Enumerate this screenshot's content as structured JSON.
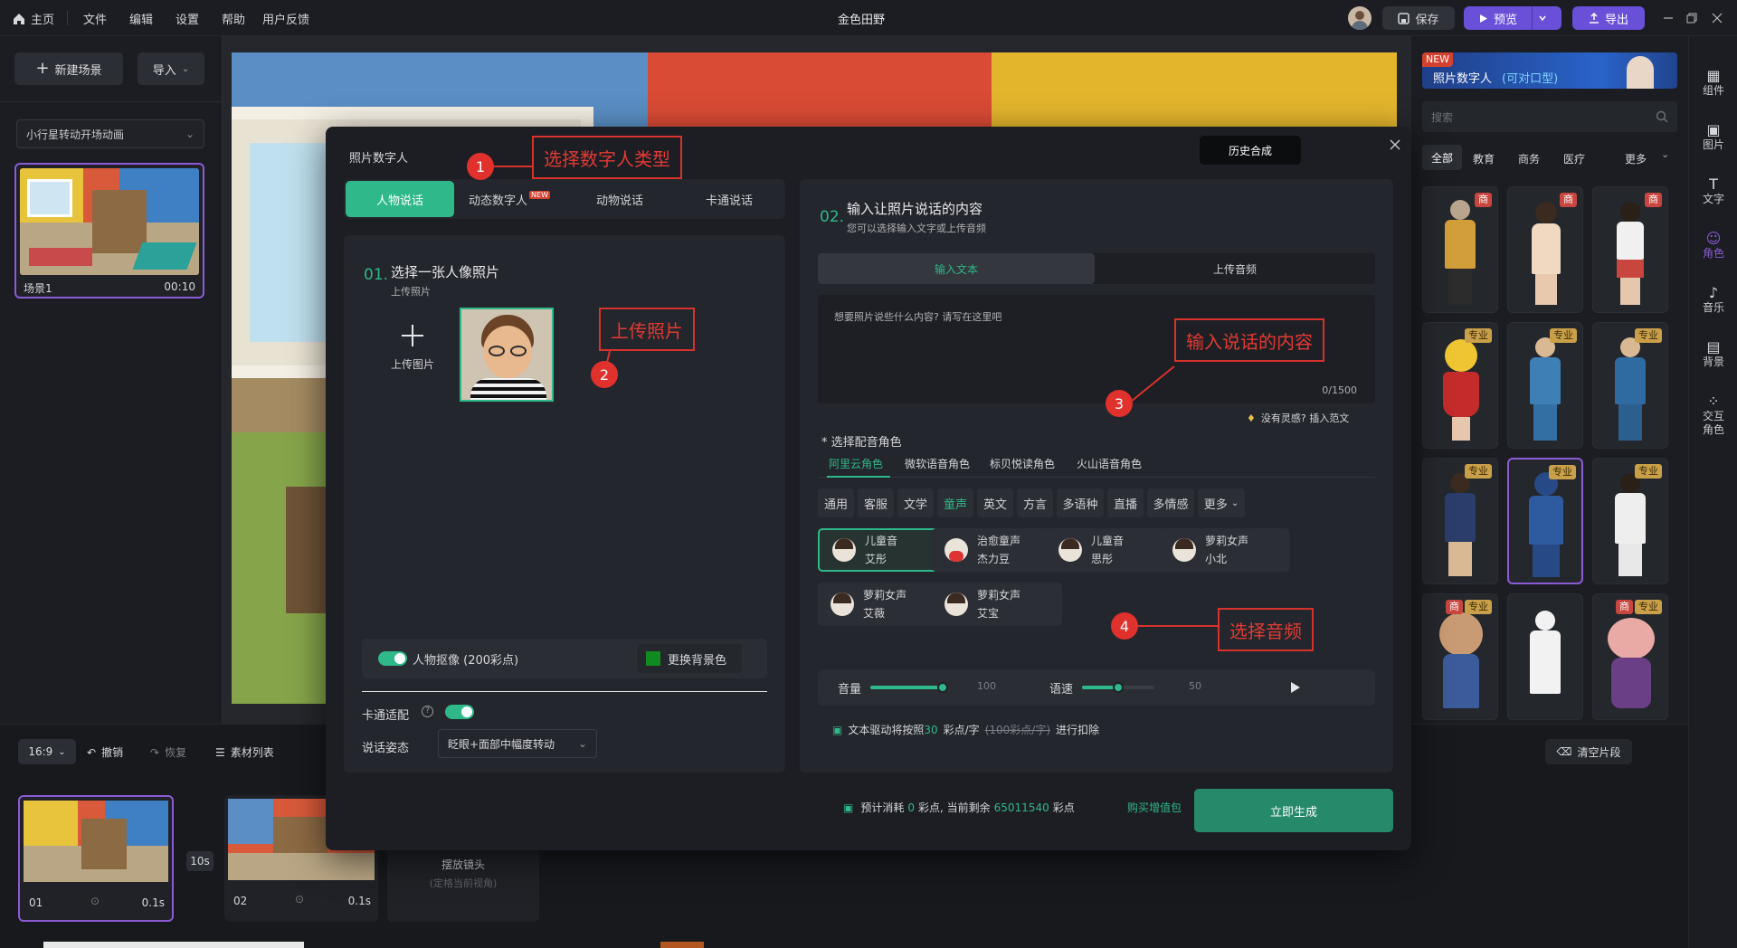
{
  "topbar": {
    "home": "主页",
    "menus": [
      "文件",
      "编辑",
      "设置",
      "帮助",
      "用户反馈"
    ],
    "title": "金色田野",
    "save": "保存",
    "preview": "预览",
    "export": "导出"
  },
  "left": {
    "new_scene": "新建场景",
    "import": "导入",
    "animation_select": "小行星转动开场动画",
    "scene_name": "场景1",
    "scene_duration": "00:10"
  },
  "assets": {
    "banner_new": "NEW",
    "banner_title": "照片数字人",
    "banner_sub": "(可对口型)",
    "search_placeholder": "搜索",
    "tabs": [
      "全部",
      "教育",
      "商务",
      "医疗",
      "更多"
    ],
    "tag_shang": "商",
    "tag_pro": "专业"
  },
  "rightbar": [
    "组件",
    "图片",
    "文字",
    "角色",
    "音乐",
    "背景",
    "交互角色"
  ],
  "timeline": {
    "ratio": "16:9",
    "undo": "撤销",
    "redo": "恢复",
    "material_list": "素材列表",
    "clear": "清空片段",
    "clips": [
      {
        "num": "01",
        "dur": "0.1s"
      },
      {
        "num": "02",
        "dur": "0.1s"
      }
    ],
    "transition": "10s",
    "place_camera": "摆放镜头",
    "place_camera_sub": "(定格当前视角)"
  },
  "modal": {
    "title": "照片数字人",
    "history": "历史合成",
    "type_tabs": [
      "人物说话",
      "动态数字人",
      "动物说话",
      "卡通说话"
    ],
    "new_badge": "NEW",
    "step1_num": "01.",
    "step1_title": "选择一张人像照片",
    "step1_sub": "上传照片",
    "upload_label": "上传图片",
    "matting_label": "人物抠像 (200彩点)",
    "replace_bg": "更换背景色",
    "cartoon_adapt": "卡通适配",
    "pose_label": "说话姿态",
    "pose_value": "眨眼+面部中幅度转动",
    "step2_num": "02.",
    "step2_title": "输入让照片说话的内容",
    "step2_sub": "您可以选择输入文字或上传音频",
    "input_tabs": [
      "输入文本",
      "上传音频"
    ],
    "textarea_placeholder": "想要照片说些什么内容? 请写在这里吧",
    "char_count": "0/1500",
    "inspiration": "没有灵感? 插入范文",
    "voice_role_label": "* 选择配音角色",
    "voice_sources": [
      "阿里云角色",
      "微软语音角色",
      "标贝悦读角色",
      "火山语音角色"
    ],
    "voice_cats": [
      "通用",
      "客服",
      "文学",
      "童声",
      "英文",
      "方言",
      "多语种",
      "直播",
      "多情感",
      "更多"
    ],
    "voices": [
      {
        "type": "儿童音",
        "name": "艾彤"
      },
      {
        "type": "治愈童声",
        "name": "杰力豆"
      },
      {
        "type": "儿童音",
        "name": "思彤"
      },
      {
        "type": "萝莉女声",
        "name": "小北"
      },
      {
        "type": "萝莉女声",
        "name": "艾薇"
      },
      {
        "type": "萝莉女声",
        "name": "艾宝"
      }
    ],
    "volume_label": "音量",
    "volume_value": "100",
    "speed_label": "语速",
    "speed_value": "50",
    "volume_level": 100,
    "speed_level": 50,
    "billing_prefix": "文本驱动将按照",
    "billing_rate": "30",
    "billing_unit": "彩点/字",
    "billing_old": "(100彩点/字)",
    "billing_suffix": "进行扣除",
    "cost_prefix": "预计消耗",
    "cost_value": "0",
    "cost_mid": "彩点, 当前剩余",
    "balance": "65011540",
    "cost_unit": "彩点",
    "buy_pack": "购买增值包",
    "generate": "立即生成"
  },
  "callouts": {
    "c1": "选择数字人类型",
    "c2": "上传照片",
    "c3": "输入说话的内容",
    "c4": "选择音频",
    "n1": "1",
    "n2": "2",
    "n3": "3",
    "n4": "4"
  },
  "colors": {
    "accent": "#2fb889",
    "purple": "#6a4fd8",
    "callout": "#e0312c"
  }
}
